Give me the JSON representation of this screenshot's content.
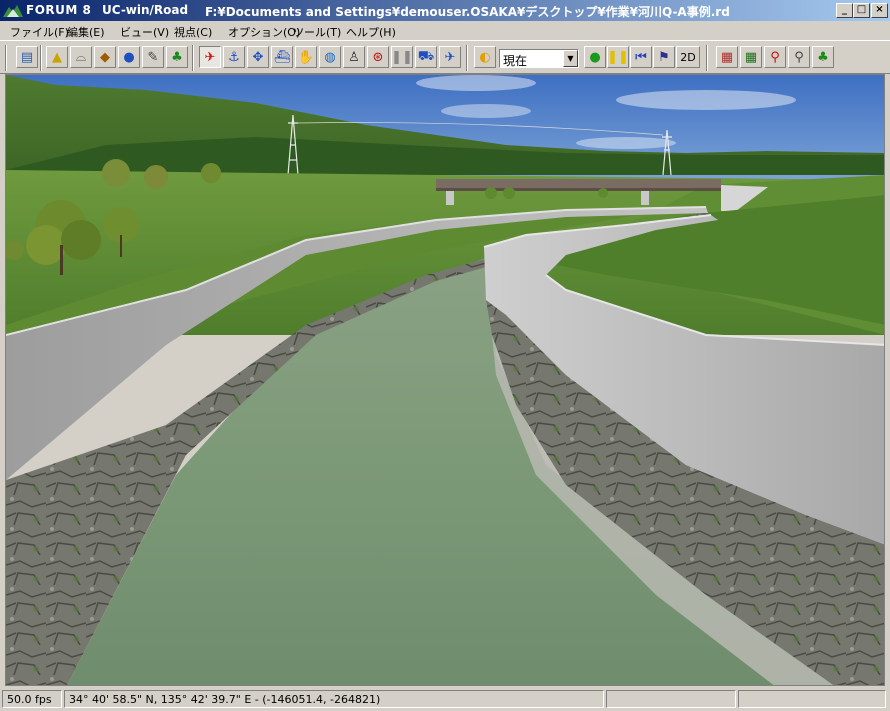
{
  "window": {
    "app_name": "FORUM 8",
    "product": "UC-win/Road",
    "file_path": "F:¥Documents and Settings¥demouser.OSAKA¥デスクトップ¥作業¥河川Q-A事例.rd",
    "controls": {
      "minimize": "_",
      "restore": "□",
      "close": "×"
    }
  },
  "menu": [
    "ファイル(F)",
    "編集(E)",
    "ビュー(V)",
    "視点(C)",
    "オプション(O)",
    "ツール(T)",
    "ヘルプ(H)"
  ],
  "toolbar": {
    "time_select_value": "現在",
    "mode_2d_label": "2D",
    "icons": [
      "open-file-icon",
      "terrain-icon",
      "road-section-icon",
      "model-icon",
      "car-icon",
      "plugin-icon",
      "tree-icon",
      "fly-camera-icon",
      "anchor-icon",
      "move-icon",
      "boat-icon",
      "rotate-view-icon",
      "globe-icon",
      "pedestrian-icon",
      "steering-icon",
      "pause-icon",
      "drive-car-icon",
      "airplane-icon",
      "sky-time-icon",
      "traffic-signal-icon",
      "yellow-pause-icon",
      "rewind-icon",
      "flag-icon",
      "map-overlay-icon",
      "grid-map-icon",
      "walker-red-icon",
      "walker-icon",
      "tree-green-icon"
    ]
  },
  "status": {
    "fps": "50.0 fps",
    "coordinates": "34° 40' 58.5\" N, 135° 42' 39.7\" E - (-146051.4, -264821)"
  },
  "colors": {
    "title_start": "#0a246a",
    "title_end": "#a6caf0",
    "chrome": "#d4d0c8"
  }
}
